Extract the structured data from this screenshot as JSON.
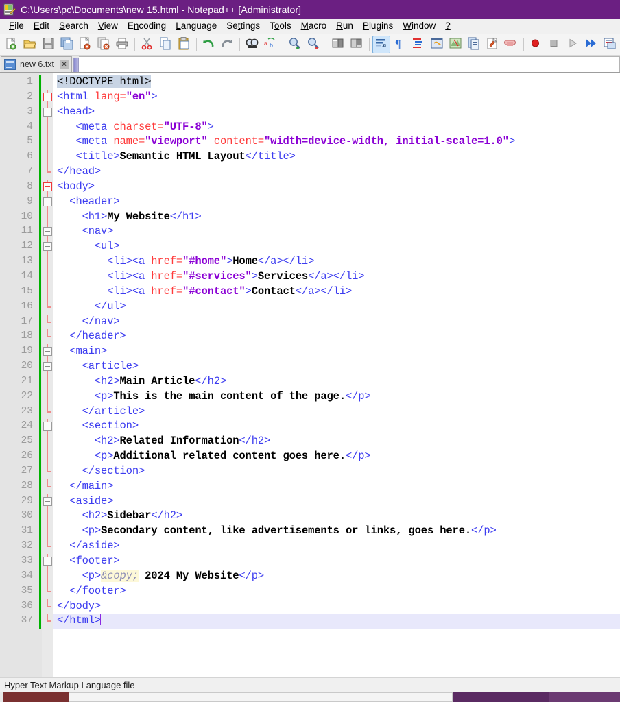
{
  "window": {
    "title": "C:\\Users\\pc\\Documents\\new 15.html - Notepad++ [Administrator]",
    "icon": "notepad-plus-plus-icon",
    "titlebar_color": "#6b1f82"
  },
  "menubar": {
    "items": [
      {
        "label": "File",
        "accel": "F"
      },
      {
        "label": "Edit",
        "accel": "E"
      },
      {
        "label": "Search",
        "accel": "S"
      },
      {
        "label": "View",
        "accel": "V"
      },
      {
        "label": "Encoding",
        "accel": "n"
      },
      {
        "label": "Language",
        "accel": "L"
      },
      {
        "label": "Settings",
        "accel": "t"
      },
      {
        "label": "Tools",
        "accel": "o"
      },
      {
        "label": "Macro",
        "accel": "M"
      },
      {
        "label": "Run",
        "accel": "R"
      },
      {
        "label": "Plugins",
        "accel": "P"
      },
      {
        "label": "Window",
        "accel": "W"
      },
      {
        "label": "?",
        "accel": "?"
      }
    ]
  },
  "toolbar": {
    "buttons": [
      {
        "name": "new-file-icon",
        "group": 0
      },
      {
        "name": "open-file-icon",
        "group": 0
      },
      {
        "name": "save-icon",
        "group": 0
      },
      {
        "name": "save-all-icon",
        "group": 0
      },
      {
        "name": "close-file-icon",
        "group": 0
      },
      {
        "name": "close-all-files-icon",
        "group": 0
      },
      {
        "name": "print-icon",
        "group": 0
      },
      {
        "name": "cut-icon",
        "group": 1
      },
      {
        "name": "copy-icon",
        "group": 1
      },
      {
        "name": "paste-icon",
        "group": 1
      },
      {
        "name": "undo-icon",
        "group": 2
      },
      {
        "name": "redo-icon",
        "group": 2
      },
      {
        "name": "find-icon",
        "group": 3
      },
      {
        "name": "replace-icon",
        "group": 3
      },
      {
        "name": "zoom-in-icon",
        "group": 4
      },
      {
        "name": "zoom-out-icon",
        "group": 4
      },
      {
        "name": "sync-vertical-scrolling-icon",
        "group": 5
      },
      {
        "name": "sync-horizontal-scrolling-icon",
        "group": 5
      },
      {
        "name": "word-wrap-icon",
        "group": 6,
        "active": true
      },
      {
        "name": "show-all-characters-icon",
        "group": 6
      },
      {
        "name": "indent-guide-icon",
        "group": 6
      },
      {
        "name": "user-defined-dialog-icon",
        "group": 6
      },
      {
        "name": "document-map-icon",
        "group": 6
      },
      {
        "name": "function-list-icon",
        "group": 6
      },
      {
        "name": "folder-as-workspace-icon",
        "group": 6
      },
      {
        "name": "monitoring-icon",
        "group": 6
      },
      {
        "name": "record-macro-icon",
        "group": 7
      },
      {
        "name": "stop-recording-macro-icon",
        "group": 7
      },
      {
        "name": "playback-macro-icon",
        "group": 7
      },
      {
        "name": "run-macro-multiple-times-icon",
        "group": 7
      },
      {
        "name": "save-current-macro-icon",
        "group": 7
      }
    ]
  },
  "tabs": [
    {
      "label": "new 6.txt",
      "active": true,
      "close_label": "✕"
    }
  ],
  "editor": {
    "total_lines": 37,
    "current_line": 37,
    "lines": [
      {
        "n": 1,
        "fold": "none",
        "change": true,
        "current": false,
        "tokens": [
          {
            "t": "sel",
            "v": "<!DOCTYPE html>"
          }
        ]
      },
      {
        "n": 2,
        "fold": "box-red",
        "change": true,
        "current": false,
        "tokens": [
          {
            "t": "tag",
            "v": "<html "
          },
          {
            "t": "attr",
            "v": "lang="
          },
          {
            "t": "val",
            "v": "\"en\""
          },
          {
            "t": "tag",
            "v": ">"
          }
        ]
      },
      {
        "n": 3,
        "fold": "box",
        "change": true,
        "current": false,
        "tokens": [
          {
            "t": "tag",
            "v": "<head>"
          }
        ]
      },
      {
        "n": 4,
        "fold": "line",
        "change": true,
        "current": false,
        "tokens": [
          {
            "t": "tag",
            "v": "   <meta "
          },
          {
            "t": "attr",
            "v": "charset="
          },
          {
            "t": "val",
            "v": "\"UTF-8\""
          },
          {
            "t": "tag",
            "v": ">"
          }
        ]
      },
      {
        "n": 5,
        "fold": "line",
        "change": true,
        "current": false,
        "tokens": [
          {
            "t": "tag",
            "v": "   <meta "
          },
          {
            "t": "attr",
            "v": "name="
          },
          {
            "t": "val",
            "v": "\"viewport\""
          },
          {
            "t": "attr",
            "v": " content="
          },
          {
            "t": "val",
            "v": "\"width=device-width, initial-scale=1.0\""
          },
          {
            "t": "tag",
            "v": ">"
          }
        ]
      },
      {
        "n": 6,
        "fold": "line",
        "change": true,
        "current": false,
        "tokens": [
          {
            "t": "tag",
            "v": "   <title>"
          },
          {
            "t": "txt",
            "v": "Semantic HTML Layout"
          },
          {
            "t": "tag",
            "v": "</title>"
          }
        ]
      },
      {
        "n": 7,
        "fold": "tail",
        "change": true,
        "current": false,
        "tokens": [
          {
            "t": "tag",
            "v": "</head>"
          }
        ]
      },
      {
        "n": 8,
        "fold": "box-red",
        "change": true,
        "current": false,
        "tokens": [
          {
            "t": "tag",
            "v": "<body>"
          }
        ]
      },
      {
        "n": 9,
        "fold": "box",
        "change": true,
        "current": false,
        "tokens": [
          {
            "t": "tag",
            "v": "  <header>"
          }
        ]
      },
      {
        "n": 10,
        "fold": "line",
        "change": true,
        "current": false,
        "tokens": [
          {
            "t": "tag",
            "v": "    <h1>"
          },
          {
            "t": "txt",
            "v": "My Website"
          },
          {
            "t": "tag",
            "v": "</h1>"
          }
        ]
      },
      {
        "n": 11,
        "fold": "box",
        "change": true,
        "current": false,
        "tokens": [
          {
            "t": "tag",
            "v": "    <nav>"
          }
        ]
      },
      {
        "n": 12,
        "fold": "box",
        "change": true,
        "current": false,
        "tokens": [
          {
            "t": "tag",
            "v": "      <ul>"
          }
        ]
      },
      {
        "n": 13,
        "fold": "line",
        "change": true,
        "current": false,
        "tokens": [
          {
            "t": "tag",
            "v": "        <li><a "
          },
          {
            "t": "attr",
            "v": "href="
          },
          {
            "t": "val",
            "v": "\"#home\""
          },
          {
            "t": "tag",
            "v": ">"
          },
          {
            "t": "txt",
            "v": "Home"
          },
          {
            "t": "tag",
            "v": "</a></li>"
          }
        ]
      },
      {
        "n": 14,
        "fold": "line",
        "change": true,
        "current": false,
        "tokens": [
          {
            "t": "tag",
            "v": "        <li><a "
          },
          {
            "t": "attr",
            "v": "href="
          },
          {
            "t": "val",
            "v": "\"#services\""
          },
          {
            "t": "tag",
            "v": ">"
          },
          {
            "t": "txt",
            "v": "Services"
          },
          {
            "t": "tag",
            "v": "</a></li>"
          }
        ]
      },
      {
        "n": 15,
        "fold": "line",
        "change": true,
        "current": false,
        "tokens": [
          {
            "t": "tag",
            "v": "        <li><a "
          },
          {
            "t": "attr",
            "v": "href="
          },
          {
            "t": "val",
            "v": "\"#contact\""
          },
          {
            "t": "tag",
            "v": ">"
          },
          {
            "t": "txt",
            "v": "Contact"
          },
          {
            "t": "tag",
            "v": "</a></li>"
          }
        ]
      },
      {
        "n": 16,
        "fold": "tail",
        "change": true,
        "current": false,
        "tokens": [
          {
            "t": "tag",
            "v": "      </ul>"
          }
        ]
      },
      {
        "n": 17,
        "fold": "tail",
        "change": true,
        "current": false,
        "tokens": [
          {
            "t": "tag",
            "v": "    </nav>"
          }
        ]
      },
      {
        "n": 18,
        "fold": "tail",
        "change": true,
        "current": false,
        "tokens": [
          {
            "t": "tag",
            "v": "  </header>"
          }
        ]
      },
      {
        "n": 19,
        "fold": "box",
        "change": true,
        "current": false,
        "tokens": [
          {
            "t": "tag",
            "v": "  <main>"
          }
        ]
      },
      {
        "n": 20,
        "fold": "box",
        "change": true,
        "current": false,
        "tokens": [
          {
            "t": "tag",
            "v": "    <article>"
          }
        ]
      },
      {
        "n": 21,
        "fold": "line",
        "change": true,
        "current": false,
        "tokens": [
          {
            "t": "tag",
            "v": "      <h2>"
          },
          {
            "t": "txt",
            "v": "Main Article"
          },
          {
            "t": "tag",
            "v": "</h2>"
          }
        ]
      },
      {
        "n": 22,
        "fold": "line",
        "change": true,
        "current": false,
        "tokens": [
          {
            "t": "tag",
            "v": "      <p>"
          },
          {
            "t": "txt",
            "v": "This is the main content of the page."
          },
          {
            "t": "tag",
            "v": "</p>"
          }
        ]
      },
      {
        "n": 23,
        "fold": "tail",
        "change": true,
        "current": false,
        "tokens": [
          {
            "t": "tag",
            "v": "    </article>"
          }
        ]
      },
      {
        "n": 24,
        "fold": "box",
        "change": true,
        "current": false,
        "tokens": [
          {
            "t": "tag",
            "v": "    <section>"
          }
        ]
      },
      {
        "n": 25,
        "fold": "line",
        "change": true,
        "current": false,
        "tokens": [
          {
            "t": "tag",
            "v": "      <h2>"
          },
          {
            "t": "txt",
            "v": "Related Information"
          },
          {
            "t": "tag",
            "v": "</h2>"
          }
        ]
      },
      {
        "n": 26,
        "fold": "line",
        "change": true,
        "current": false,
        "tokens": [
          {
            "t": "tag",
            "v": "      <p>"
          },
          {
            "t": "txt",
            "v": "Additional related content goes here."
          },
          {
            "t": "tag",
            "v": "</p>"
          }
        ]
      },
      {
        "n": 27,
        "fold": "tail",
        "change": true,
        "current": false,
        "tokens": [
          {
            "t": "tag",
            "v": "    </section>"
          }
        ]
      },
      {
        "n": 28,
        "fold": "tail",
        "change": true,
        "current": false,
        "tokens": [
          {
            "t": "tag",
            "v": "  </main>"
          }
        ]
      },
      {
        "n": 29,
        "fold": "box",
        "change": true,
        "current": false,
        "tokens": [
          {
            "t": "tag",
            "v": "  <aside>"
          }
        ]
      },
      {
        "n": 30,
        "fold": "line",
        "change": true,
        "current": false,
        "tokens": [
          {
            "t": "tag",
            "v": "    <h2>"
          },
          {
            "t": "txt",
            "v": "Sidebar"
          },
          {
            "t": "tag",
            "v": "</h2>"
          }
        ]
      },
      {
        "n": 31,
        "fold": "line",
        "change": true,
        "current": false,
        "tokens": [
          {
            "t": "tag",
            "v": "    <p>"
          },
          {
            "t": "txt",
            "v": "Secondary content, like advertisements or links, goes here."
          },
          {
            "t": "tag",
            "v": "</p>"
          }
        ]
      },
      {
        "n": 32,
        "fold": "tail",
        "change": true,
        "current": false,
        "tokens": [
          {
            "t": "tag",
            "v": "  </aside>"
          }
        ]
      },
      {
        "n": 33,
        "fold": "box",
        "change": true,
        "current": false,
        "tokens": [
          {
            "t": "tag",
            "v": "  <footer>"
          }
        ]
      },
      {
        "n": 34,
        "fold": "line",
        "change": true,
        "current": false,
        "tokens": [
          {
            "t": "tag",
            "v": "    <p>"
          },
          {
            "t": "ent",
            "v": "&copy;"
          },
          {
            "t": "txt",
            "v": " 2024 My Website"
          },
          {
            "t": "tag",
            "v": "</p>"
          }
        ]
      },
      {
        "n": 35,
        "fold": "tail",
        "change": true,
        "current": false,
        "tokens": [
          {
            "t": "tag",
            "v": "  </footer>"
          }
        ]
      },
      {
        "n": 36,
        "fold": "tail",
        "change": true,
        "current": false,
        "tokens": [
          {
            "t": "tag",
            "v": "</body>"
          }
        ]
      },
      {
        "n": 37,
        "fold": "tail-end",
        "change": true,
        "current": true,
        "tokens": [
          {
            "t": "tag",
            "v": "</html>"
          },
          {
            "t": "caret",
            "v": ""
          }
        ]
      }
    ]
  },
  "statusbar": {
    "text": "Hyper Text Markup Language file"
  }
}
